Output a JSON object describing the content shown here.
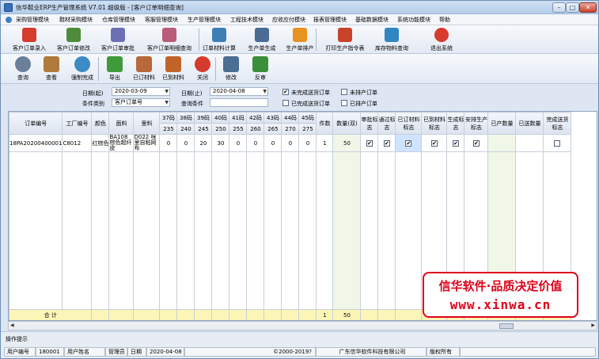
{
  "window": {
    "title": "信华鞋业ERP生产管理系统  V7.01  超级版 - [客户订单明细查询]"
  },
  "menu": [
    "采购管理模块",
    "鞋材采购模块",
    "仓库管理模块",
    "客服管理模块",
    "生产管理模块",
    "工程技术模块",
    "应收应付模块",
    "报表管理模块",
    "基础数据模块",
    "系统功能模块",
    "帮助"
  ],
  "toolbar1": [
    {
      "label": "客户订单录入",
      "icon": "acrobat-icon",
      "color": "#d43c2c"
    },
    {
      "label": "客户订单修改",
      "icon": "edit-doc-icon",
      "color": "#4f8c3a"
    },
    {
      "label": "客户订单审批",
      "icon": "approve-doc-icon",
      "color": "#6d6fb5"
    },
    {
      "label": "客户订单明细查询",
      "icon": "query-doc-icon",
      "color": "#b85c7a"
    },
    {
      "label": "订单材料计算",
      "icon": "calc-doc-icon",
      "color": "#3d7fb5"
    },
    {
      "label": "生产单生成",
      "icon": "generate-doc-icon",
      "color": "#4b6b93"
    },
    {
      "label": "生产单排产",
      "icon": "schedule-gear-icon",
      "color": "#e8921f"
    },
    {
      "label": "打印生产指令表",
      "icon": "print-doc-icon",
      "color": "#c9422a"
    },
    {
      "label": "库存物料查询",
      "icon": "inventory-icon",
      "color": "#2f86c2"
    },
    {
      "label": "退出系统",
      "icon": "exit-icon",
      "color": "#d83a2c"
    }
  ],
  "toolbar2": [
    {
      "label": "查询",
      "icon": "magnifier-icon",
      "color": "#6a7f9a"
    },
    {
      "label": "查看",
      "icon": "view-book-icon",
      "color": "#b07a3c"
    },
    {
      "label": "强制完成",
      "icon": "force-complete-icon",
      "color": "#3c8bc4"
    },
    {
      "label": "导出",
      "icon": "export-arrow-icon",
      "color": "#3f9a3a"
    },
    {
      "label": "已订材料",
      "icon": "ordered-material-icon",
      "color": "#b9683b"
    },
    {
      "label": "已到材料",
      "icon": "received-home-icon",
      "color": "#c2642a"
    },
    {
      "label": "关闭",
      "icon": "close-circle-icon",
      "color": "#d63a2c"
    },
    {
      "label": "修改",
      "icon": "modify-icon",
      "color": "#4a6e94"
    },
    {
      "label": "反审",
      "icon": "reverse-approve-icon",
      "color": "#3a8f3a"
    }
  ],
  "filters": {
    "date_from_label": "日期(起)",
    "date_from": "2020-03-09",
    "date_to_label": "日期(止)",
    "date_to": "2020-04-08",
    "cond_type_label": "条件类别",
    "cond_type": "客户订单号",
    "cond_label": "查询条件",
    "cond": "",
    "chk_unfinished": "未完成送货订单",
    "chk_unscheduled": "未排产订单",
    "chk_finished": "已完成送货订单",
    "chk_scheduled": "已排产订单",
    "checked_unfinished": "✔",
    "checked_finished": ""
  },
  "grid": {
    "headers": {
      "order_no": "订单编号",
      "factory_no": "工厂编号",
      "color": "颜色",
      "upper": "面料",
      "lining": "里料",
      "sizes": [
        "37码",
        "38码",
        "39码",
        "40码",
        "41码",
        "42码",
        "43码",
        "44码",
        "45码"
      ],
      "size_mm": [
        "235",
        "240",
        "245",
        "250",
        "255",
        "260",
        "265",
        "270",
        "275"
      ],
      "pieces": "件数",
      "qty": "数量(双)",
      "approved": "审批标志",
      "passed": "通过标志",
      "ordered_mat": "已订材料标志",
      "received_mat": "已到材料标志",
      "generated": "生成标志",
      "scheduled": "安排生产标志",
      "produced_qty": "已产数量",
      "shipped_qty": "已送数量",
      "shipped_done": "完成送货标志"
    },
    "rows": [
      {
        "order_no": "18PA20200400001",
        "factory_no": "C8012",
        "color": "红棕色",
        "upper": "BA108 棕色超纤皮",
        "lining": "D022 咪里自粘网布",
        "sizes": [
          "0",
          "0",
          "20",
          "30",
          "0",
          "0",
          "0",
          "0",
          "0"
        ],
        "pieces": "1",
        "qty": "50",
        "approved": "✔",
        "passed": "✔",
        "ordered_mat": "✔",
        "received_mat": "✔",
        "generated": "✔",
        "scheduled": "✔",
        "produced_qty": "",
        "shipped_qty": "",
        "shipped_done": ""
      }
    ],
    "sum": {
      "label": "合 计",
      "pieces": "1",
      "qty": "50"
    }
  },
  "status": {
    "hint": "操作提示",
    "user_no_label": "用户编号",
    "user_no": "180001",
    "user_name_label": "用户姓名",
    "user_name": "管理员",
    "date_label": "日期",
    "date": "2020-04-08",
    "copyright": "©2000-2019?",
    "company": "广东信华软件科技有限公司",
    "rights": "版权所有"
  },
  "watermark": {
    "line1": "信华软件·品质决定价值",
    "line2": "www.xinwa.cn"
  }
}
